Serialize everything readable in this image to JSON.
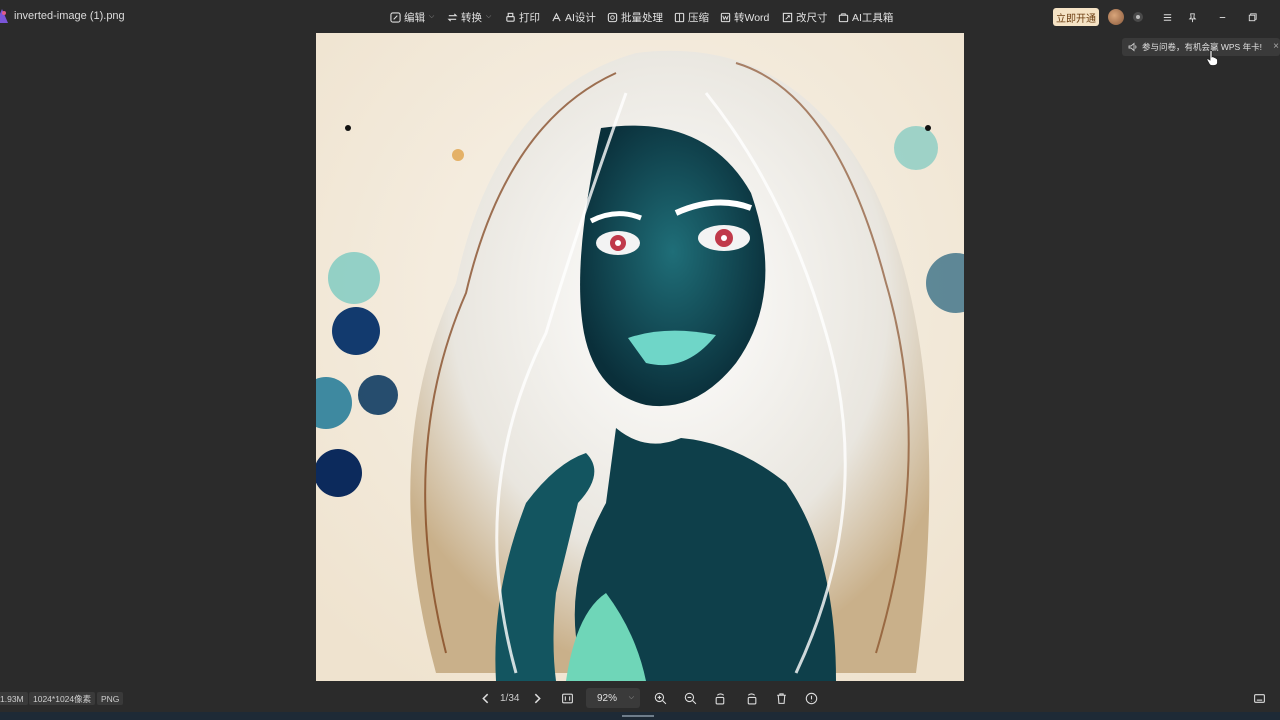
{
  "titlebar": {
    "file_name": "inverted-image (1).png",
    "menu": [
      {
        "label": "编辑",
        "icon": "edit-icon",
        "dropdown": true
      },
      {
        "label": "转换",
        "icon": "convert-icon",
        "dropdown": true
      },
      {
        "label": "打印",
        "icon": "print-icon",
        "dropdown": false
      },
      {
        "label": "AI设计",
        "icon": "ai-design-icon",
        "dropdown": false
      },
      {
        "label": "批量处理",
        "icon": "batch-icon",
        "dropdown": false
      },
      {
        "label": "压缩",
        "icon": "compress-icon",
        "dropdown": false
      },
      {
        "label": "转Word",
        "icon": "word-icon",
        "dropdown": false
      },
      {
        "label": "改尺寸",
        "icon": "resize-icon",
        "dropdown": false
      },
      {
        "label": "AI工具箱",
        "icon": "toolbox-icon",
        "dropdown": false
      }
    ],
    "vip_button": "立即开通"
  },
  "tooltip": {
    "text": "参与问卷，有机会赢 WPS 年卡!"
  },
  "image": {
    "description_icon": "inverted-portrait-image"
  },
  "bottombar": {
    "file_size": "1.93M",
    "dimensions": "1024*1024像素",
    "format": "PNG",
    "page": "1/34",
    "zoom": "92%"
  },
  "colors": {
    "background": "#2b2b2b",
    "vip_bg": "#f5e3c5",
    "panel": "#3a3a3a"
  }
}
